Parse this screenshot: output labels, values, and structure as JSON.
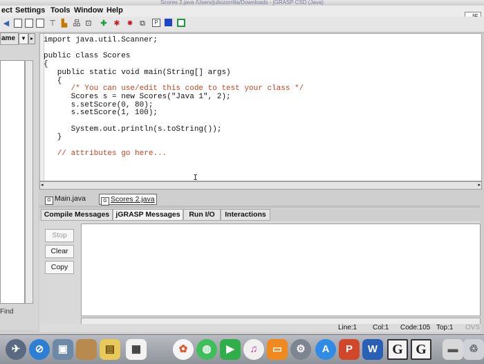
{
  "window": {
    "title": "Scores 2.java  /Users/juliozorrilla/Downloads - jGRASP CSD (Java)"
  },
  "menubar": {
    "items": [
      "ect",
      "Settings",
      "Tools",
      "Window",
      "Help"
    ],
    "minimize_label": "- |5"
  },
  "browse": {
    "name_header": "ame",
    "find_label": "Find"
  },
  "editor": {
    "lines": [
      "import java.util.Scanner;",
      "",
      "public class Scores",
      "{",
      "   public static void main(String[] args)",
      "   {",
      "      /* You can use/edit this code to test your class */",
      "      Scores s = new Scores(\"Java 1\", 2);",
      "      s.setScore(0, 80);",
      "      s.setScore(1, 100);",
      "",
      "      System.out.println(s.toString());",
      "   }",
      "",
      "   // attributes go here..."
    ]
  },
  "file_tabs": [
    "Main.java",
    "Scores 2.java"
  ],
  "message_tabs": [
    "Compile Messages",
    "jGRASP Messages",
    "Run I/O",
    "Interactions"
  ],
  "message_buttons": {
    "stop": "Stop",
    "clear": "Clear",
    "copy": "Copy"
  },
  "status": {
    "line": "Line:1",
    "col": "Col:1",
    "code": "Code:105",
    "top": "Top:1",
    "mode": "OVS"
  },
  "colors": {
    "comment": "#c8431e",
    "string": "#b04a10"
  },
  "dock_icons": [
    "launchpad-icon",
    "safari-icon",
    "preview-icon",
    "folder-icon",
    "notes-icon",
    "calendar-icon",
    "photos-icon",
    "messages-icon",
    "facetime-icon",
    "itunes-icon",
    "ibooks-icon",
    "system-preferences-icon",
    "app-store-icon",
    "powerpoint-icon",
    "word-icon",
    "jgrasp-icon",
    "jgrasp-icon-2",
    "trash-icon"
  ]
}
